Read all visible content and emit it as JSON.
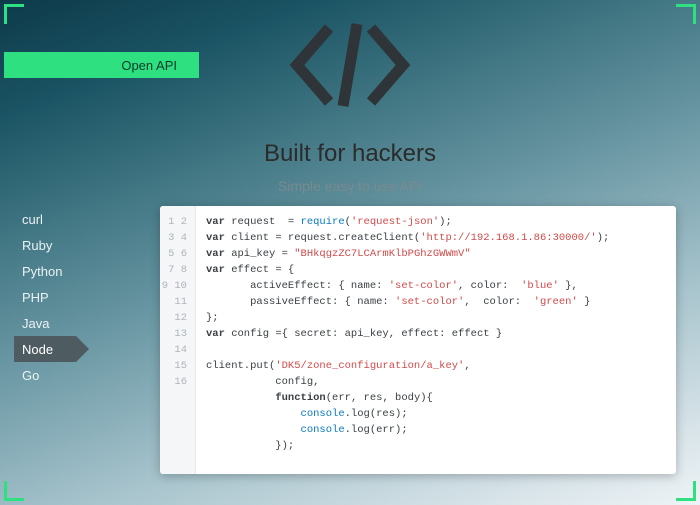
{
  "badge": {
    "label": "Open API"
  },
  "hero": {
    "title": "Built for hackers",
    "subtitle": "Simple easy to use API",
    "icon": "code-brackets-icon"
  },
  "tabs": [
    {
      "label": "curl",
      "active": false
    },
    {
      "label": "Ruby",
      "active": false
    },
    {
      "label": "Python",
      "active": false
    },
    {
      "label": "PHP",
      "active": false
    },
    {
      "label": "Java",
      "active": false
    },
    {
      "label": "Node",
      "active": true
    },
    {
      "label": "Go",
      "active": false
    }
  ],
  "code": {
    "line_count": 16,
    "tokens": [
      [
        [
          "kw",
          "var"
        ],
        [
          "",
          " request  = "
        ],
        [
          "fn",
          "require"
        ],
        [
          "",
          "("
        ],
        [
          "str",
          "'request-json'"
        ],
        [
          "",
          ");"
        ]
      ],
      [
        [
          "kw",
          "var"
        ],
        [
          "",
          " client = request.createClient("
        ],
        [
          "str",
          "'http://192.168.1.86:30000/'"
        ],
        [
          "",
          ");"
        ]
      ],
      [
        [
          "kw",
          "var"
        ],
        [
          "",
          " api_key = "
        ],
        [
          "str",
          "\"BHkqgzZC7LCArmKlbPGhzGWWmV\""
        ]
      ],
      [
        [
          "kw",
          "var"
        ],
        [
          "",
          " effect = {"
        ]
      ],
      [
        [
          "",
          "       activeEffect: { name: "
        ],
        [
          "str",
          "'set-color'"
        ],
        [
          "",
          ", color:  "
        ],
        [
          "str",
          "'blue'"
        ],
        [
          "",
          " },"
        ]
      ],
      [
        [
          "",
          "       passiveEffect: { name: "
        ],
        [
          "str",
          "'set-color'"
        ],
        [
          "",
          "",
          ""
        ],
        [
          "",
          ",  color:  "
        ],
        [
          "str",
          "'green'"
        ],
        [
          "",
          " }"
        ]
      ],
      [
        [
          "",
          "};"
        ]
      ],
      [
        [
          "kw",
          "var"
        ],
        [
          "",
          " config ={ secret: api_key, effect: effect }"
        ]
      ],
      [
        [
          "",
          ""
        ]
      ],
      [
        [
          "",
          "client.put("
        ],
        [
          "str",
          "'DK5/zone_configuration/a_key'"
        ],
        [
          "",
          ","
        ]
      ],
      [
        [
          "",
          "           config,"
        ]
      ],
      [
        [
          "",
          "           "
        ],
        [
          "kw",
          "function"
        ],
        [
          "",
          "(err, res, body){"
        ]
      ],
      [
        [
          "",
          "               "
        ],
        [
          "fn",
          "console"
        ],
        [
          "",
          ".log(res);"
        ]
      ],
      [
        [
          "",
          "               "
        ],
        [
          "fn",
          "console"
        ],
        [
          "",
          ".log(err);"
        ]
      ],
      [
        [
          "",
          "           });"
        ]
      ],
      [
        [
          "",
          ""
        ]
      ]
    ]
  }
}
